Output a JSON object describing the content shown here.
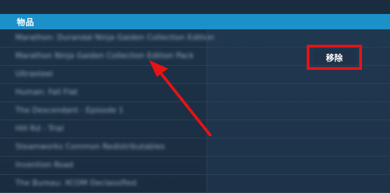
{
  "header": {
    "label": "物品"
  },
  "items": [
    {
      "label": "Marathon: Durandal Ninja Gaiden Collection Edition"
    },
    {
      "label": "Marathon Ninja Gaiden Collection Edition Pack"
    },
    {
      "label": "Ultrasteel"
    },
    {
      "label": "Human: Fall Flat"
    },
    {
      "label": "The Descendant - Episode 1"
    },
    {
      "label": "Hill Rd - Trial"
    },
    {
      "label": "Steamworks Common Redistributables"
    },
    {
      "label": "Invention Road"
    },
    {
      "label": "The Bureau: XCOM Declassified"
    }
  ],
  "actions": {
    "remove_label": "移除"
  },
  "annotation": {
    "arrow_color": "#e81313",
    "box_color": "#e81313"
  }
}
